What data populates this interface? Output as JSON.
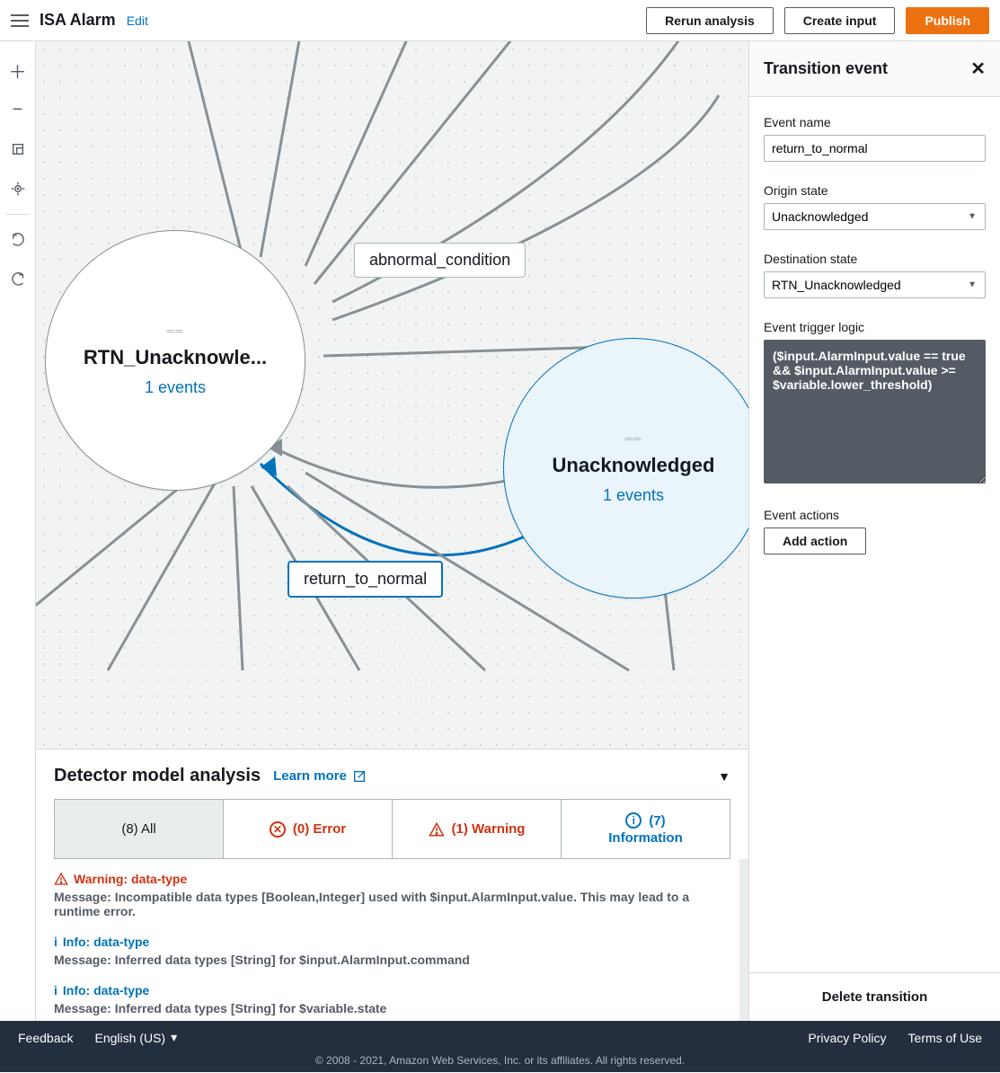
{
  "header": {
    "title": "ISA Alarm",
    "edit": "Edit",
    "rerun": "Rerun analysis",
    "create_input": "Create input",
    "publish": "Publish"
  },
  "canvas": {
    "states": [
      {
        "name": "RTN_Unacknowle...",
        "events": "1 events",
        "selected": false
      },
      {
        "name": "Unacknowledged",
        "events": "1 events",
        "selected": true
      }
    ],
    "labels": [
      {
        "text": "abnormal_condition",
        "selected": false
      },
      {
        "text": "return_to_normal",
        "selected": true
      }
    ]
  },
  "analysis": {
    "title": "Detector model analysis",
    "learn_more": "Learn more",
    "tabs": {
      "all": "(8) All",
      "error": "(0) Error",
      "warning": "(1) Warning",
      "info_count": "(7)",
      "info_label": "Information"
    },
    "messages": [
      {
        "kind": "warn",
        "head": "Warning: data-type",
        "body": "Message: Incompatible data types [Boolean,Integer] used with $input.AlarmInput.value. This may lead to a runtime error."
      },
      {
        "kind": "info",
        "head": "Info: data-type",
        "body": "Message: Inferred data types [String] for $input.AlarmInput.command"
      },
      {
        "kind": "info",
        "head": "Info: data-type",
        "body": "Message: Inferred data types [String] for $variable.state"
      }
    ]
  },
  "right": {
    "title": "Transition event",
    "event_name_label": "Event name",
    "event_name": "return_to_normal",
    "origin_label": "Origin state",
    "origin": "Unacknowledged",
    "dest_label": "Destination state",
    "dest": "RTN_Unacknowledged",
    "trigger_label": "Event trigger logic",
    "trigger": "($input.AlarmInput.value == true && $input.AlarmInput.value >= $variable.lower_threshold)",
    "actions_label": "Event actions",
    "add_action": "Add action",
    "delete": "Delete transition"
  },
  "footer": {
    "feedback": "Feedback",
    "lang": "English (US)",
    "privacy": "Privacy Policy",
    "terms": "Terms of Use",
    "copy": "© 2008 - 2021, Amazon Web Services, Inc. or its affiliates. All rights reserved."
  }
}
